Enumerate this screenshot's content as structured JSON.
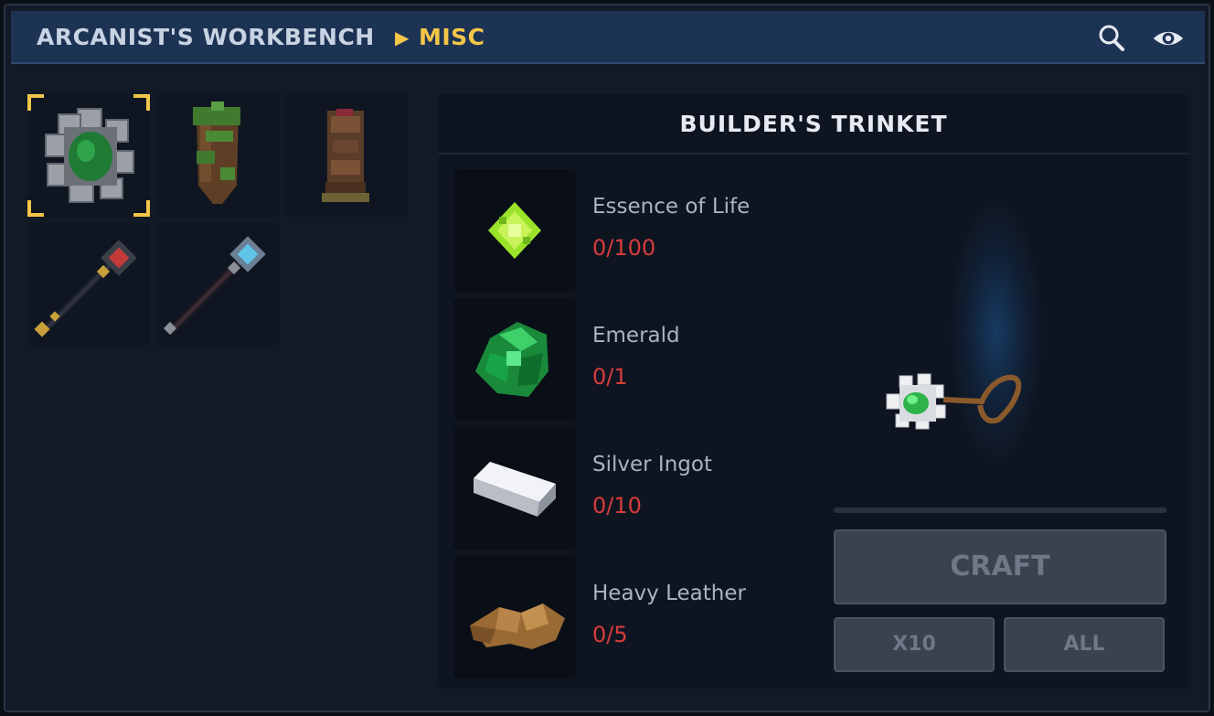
{
  "header": {
    "root_label": "ARCANIST'S WORKBENCH",
    "separator_glyph": "▶",
    "current_label": "MISC",
    "icons": [
      "search-icon",
      "eye-icon"
    ]
  },
  "items_grid": {
    "items": [
      {
        "name": "builders-trinket",
        "selected": true
      },
      {
        "name": "mossy-wooden-totem",
        "selected": false
      },
      {
        "name": "carved-wooden-totem",
        "selected": false
      },
      {
        "name": "ruby-staff",
        "selected": false
      },
      {
        "name": "sapphire-staff",
        "selected": false
      }
    ]
  },
  "recipe": {
    "title": "BUILDER'S TRINKET",
    "ingredients": [
      {
        "name": "Essence of Life",
        "count": "0/100",
        "icon": "essence-icon"
      },
      {
        "name": "Emerald",
        "count": "0/1",
        "icon": "emerald-icon"
      },
      {
        "name": "Silver Ingot",
        "count": "0/10",
        "icon": "silver-ingot-icon"
      },
      {
        "name": "Heavy Leather",
        "count": "0/5",
        "icon": "leather-icon"
      }
    ],
    "progress": 0
  },
  "actions": {
    "craft_label": "CRAFT",
    "x10_label": "X10",
    "all_label": "ALL"
  },
  "colors": {
    "accent": "#f3c649",
    "missing": "#d63c3c",
    "header_bg": "#1d3354"
  }
}
